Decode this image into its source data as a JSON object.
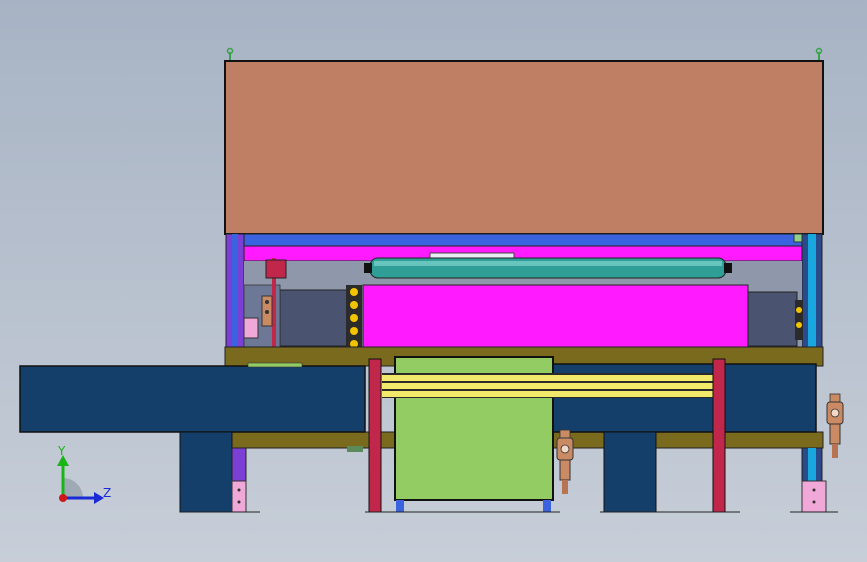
{
  "view": {
    "background_top": "#a7b3c4",
    "background_bottom": "#c7ced8"
  },
  "colors": {
    "cover": "#bf7f64",
    "frame_blue": "#2a4a8a",
    "violet": "#7b3fd6",
    "blue_strip": "#3b63e0",
    "magenta": "#ff1aff",
    "roller": "#2f9e96",
    "gray_box": "#4a5470",
    "olive": "#7a6a1e",
    "navy": "#143f6b",
    "green": "#92cc62",
    "red": "#c0274a",
    "yellow": "#f2e86a",
    "copper": "#c98a64",
    "pink": "#f0a8d8",
    "cyan": "#19a7e0"
  },
  "triad": {
    "axes": [
      {
        "label": "Y",
        "color": "#18b418"
      },
      {
        "label": "Z",
        "color": "#1a2ad6"
      },
      {
        "label": "",
        "color": "#d01818"
      }
    ]
  },
  "icons": [
    "triad-icon",
    "lifting-eye-icon",
    "pneumatic-valve-icon"
  ]
}
